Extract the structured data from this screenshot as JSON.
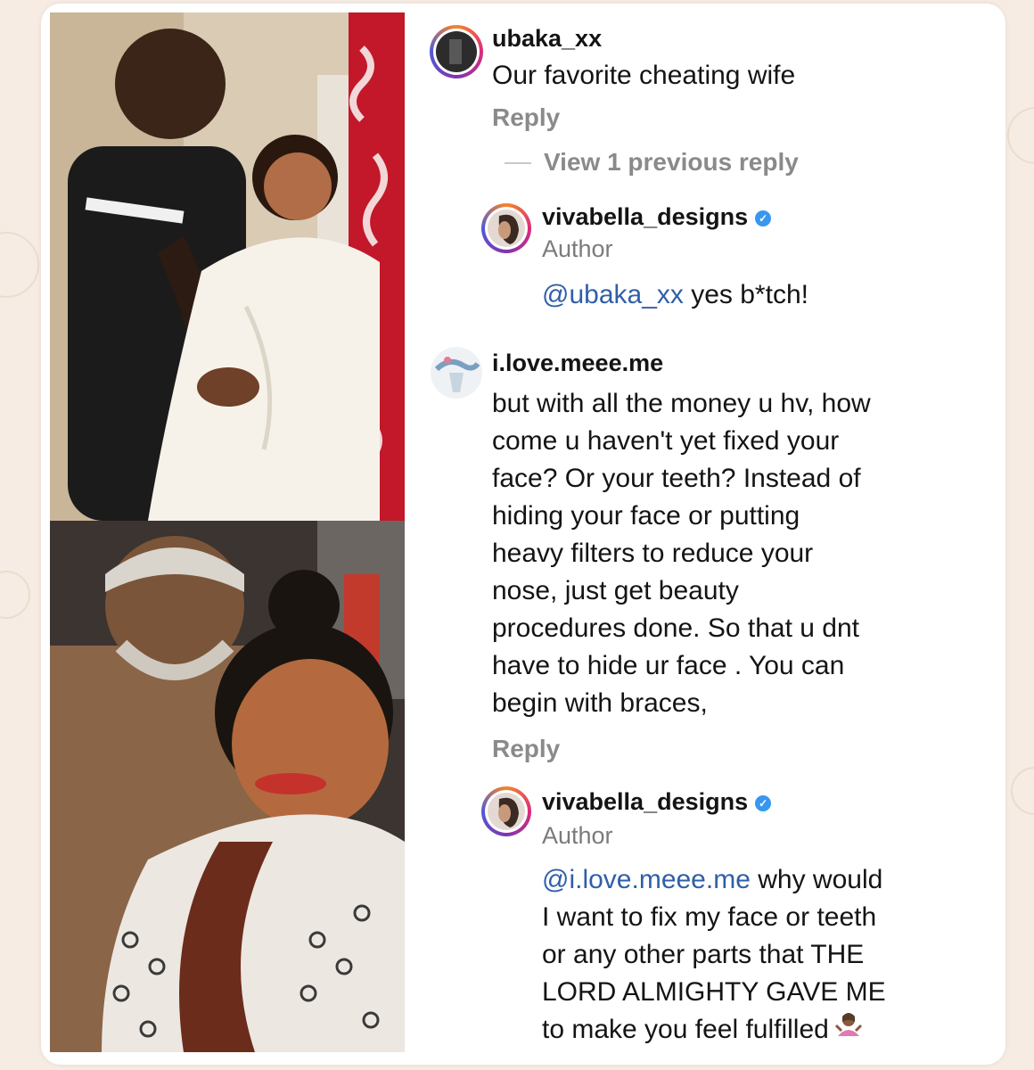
{
  "theme": {
    "background": "#f6ece3",
    "card": "#ffffff",
    "mention_color": "#2f5fa8",
    "verified_color": "#3897f0"
  },
  "photos": [
    {
      "name": "couple-photo-top",
      "description_icon": "photo-image"
    },
    {
      "name": "couple-photo-bottom",
      "description_icon": "photo-image"
    }
  ],
  "comments": {
    "c1": {
      "username": "ubaka_xx",
      "text": "Our favorite cheating wife",
      "reply_label": "Reply",
      "view_replies_label": "View 1 previous reply"
    },
    "r1": {
      "username": "vivabella_designs",
      "verified": "✓",
      "role": "Author",
      "mention": "@ubaka_xx",
      "text": " yes b*tch!"
    },
    "c2": {
      "username": "i.love.meee.me",
      "lines": [
        "but with all the money u hv, how",
        "come u haven't yet fixed your",
        "face? Or your teeth? Instead of",
        "hiding your face or  putting",
        "heavy filters to reduce your",
        "nose, just get beauty",
        "procedures done. So that u dnt",
        "have to hide ur face . You can",
        "begin with braces,"
      ],
      "reply_label": "Reply"
    },
    "r2": {
      "username": "vivabella_designs",
      "verified": "✓",
      "role": "Author",
      "mention": "@i.love.meee.me",
      "first_line_rest": " why would",
      "lines": [
        "I want to fix my face or teeth",
        "or any other parts that THE",
        "LORD ALMIGHTY GAVE ME",
        "to make you feel fulfilled"
      ],
      "emoji_icon": "shrug-emoji-icon"
    }
  }
}
